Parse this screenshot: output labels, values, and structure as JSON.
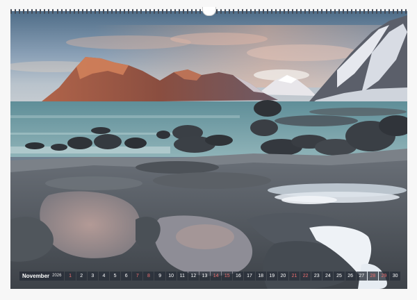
{
  "calendar": {
    "month": "November",
    "year": "2026",
    "days": [
      "1",
      "2",
      "3",
      "4",
      "5",
      "6",
      "7",
      "8",
      "9",
      "10",
      "11",
      "12",
      "13",
      "14",
      "15",
      "16",
      "17",
      "18",
      "19",
      "20",
      "21",
      "22",
      "23",
      "24",
      "25",
      "26",
      "27",
      "28",
      "29",
      "30"
    ],
    "weekend_days": [
      "1",
      "7",
      "8",
      "14",
      "15",
      "21",
      "22",
      "28",
      "29"
    ]
  },
  "colors": {
    "weekend": "#f07070",
    "bar_background": "#282e38"
  }
}
